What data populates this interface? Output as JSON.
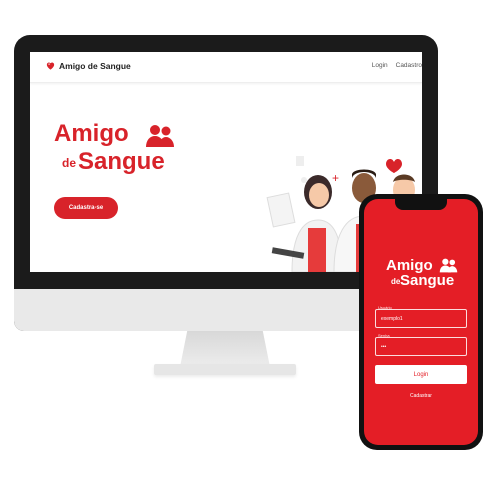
{
  "colors": {
    "brand_red": "#d8232a",
    "phone_red": "#e41e26"
  },
  "desktop": {
    "nav": {
      "brand": "Amigo de Sangue",
      "brand_icon": "heart-icon",
      "links": {
        "login": "Login",
        "register": "Cadastro"
      }
    },
    "hero": {
      "logo_line1": "Amigo",
      "logo_de": "de",
      "logo_line2": "Sangue",
      "logo_icon": "people-hug-icon",
      "cta": "Cadastra-se",
      "illustration": "doctors-illustration"
    }
  },
  "phone": {
    "logo_line1": "Amigo",
    "logo_de": "de",
    "logo_line2": "Sangue",
    "logo_icon": "people-hug-icon",
    "user": {
      "label": "Usuário",
      "value": "exemplo1"
    },
    "password": {
      "label": "Senha",
      "value": "•••"
    },
    "login": "Login",
    "register": "Cadastrar"
  }
}
